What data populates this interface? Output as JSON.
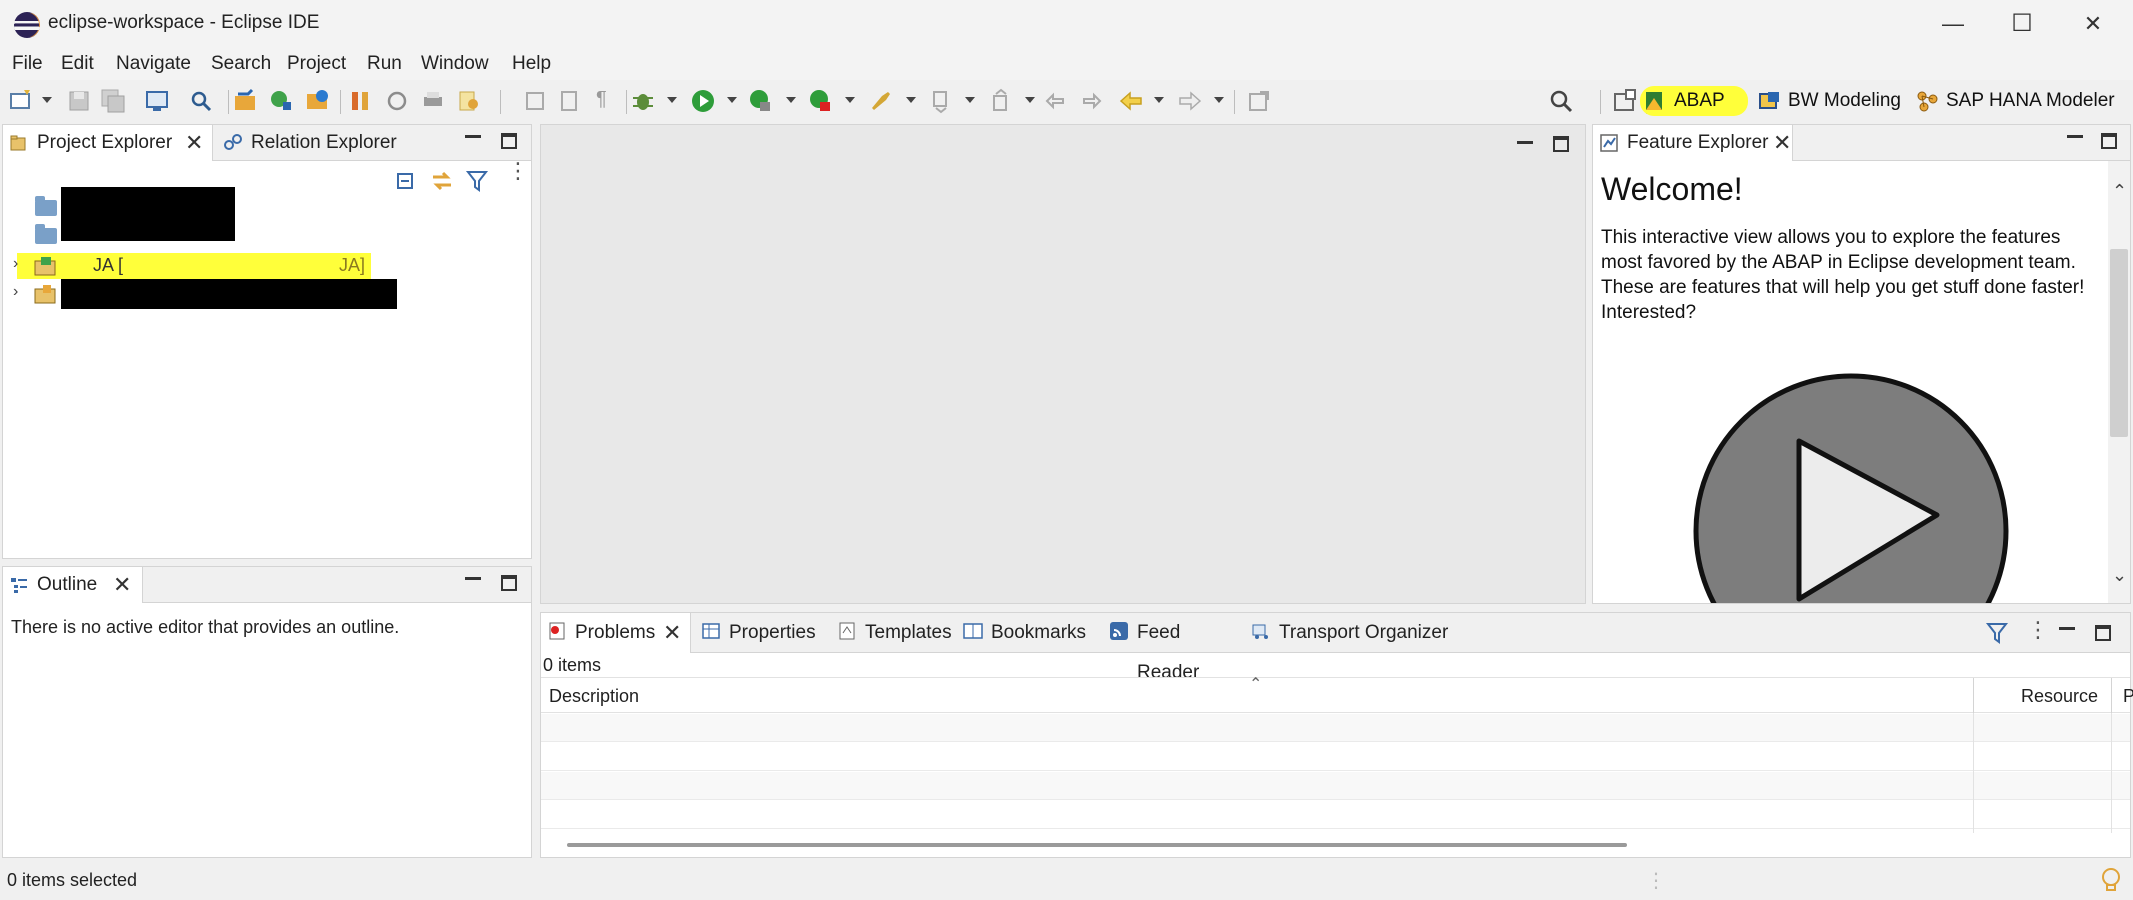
{
  "window": {
    "title": "eclipse-workspace - Eclipse IDE",
    "controls": {
      "minimize": "—",
      "maximize": "☐",
      "close": "✕"
    }
  },
  "menu": {
    "items": [
      "File",
      "Edit",
      "Navigate",
      "Search",
      "Project",
      "Run",
      "Window",
      "Help"
    ]
  },
  "toolbar": {
    "perspectives": [
      {
        "label": "ABAP",
        "highlighted": true
      },
      {
        "label": "BW Modeling",
        "highlighted": false
      },
      {
        "label": "SAP HANA Modeler",
        "highlighted": false
      }
    ],
    "highlight_color": "#ffff3a"
  },
  "project_explorer": {
    "tabs": [
      {
        "label": "Project Explorer",
        "active": true
      },
      {
        "label": "Relation Explorer",
        "active": false
      }
    ],
    "tree": [
      {
        "label": "",
        "redacted": true
      },
      {
        "label": "",
        "redacted": true
      },
      {
        "label": "JA [",
        "suffix": "JA]",
        "highlighted": true
      },
      {
        "label": "",
        "redacted": true
      }
    ]
  },
  "outline": {
    "tab_label": "Outline",
    "message": "There is no active editor that provides an outline."
  },
  "feature_explorer": {
    "tab_label": "Feature Explorer",
    "heading": "Welcome!",
    "body": "This interactive view allows you to explore the features most favored by the ABAP in Eclipse development team. These are features that will help you get stuff done faster! Interested?"
  },
  "bottom_panel": {
    "tabs": [
      {
        "label": "Problems",
        "active": true
      },
      {
        "label": "Properties"
      },
      {
        "label": "Templates"
      },
      {
        "label": "Bookmarks"
      },
      {
        "label": "Feed Reader"
      },
      {
        "label": "Transport Organizer"
      }
    ],
    "count": "0 items",
    "columns": [
      "Description",
      "Resource",
      "P"
    ]
  },
  "status": {
    "text": "0 items selected"
  },
  "colors": {
    "accent_green": "#2e9d3a",
    "folder_blue": "#7aa0c8",
    "play_grey": "#7d7d7d"
  }
}
